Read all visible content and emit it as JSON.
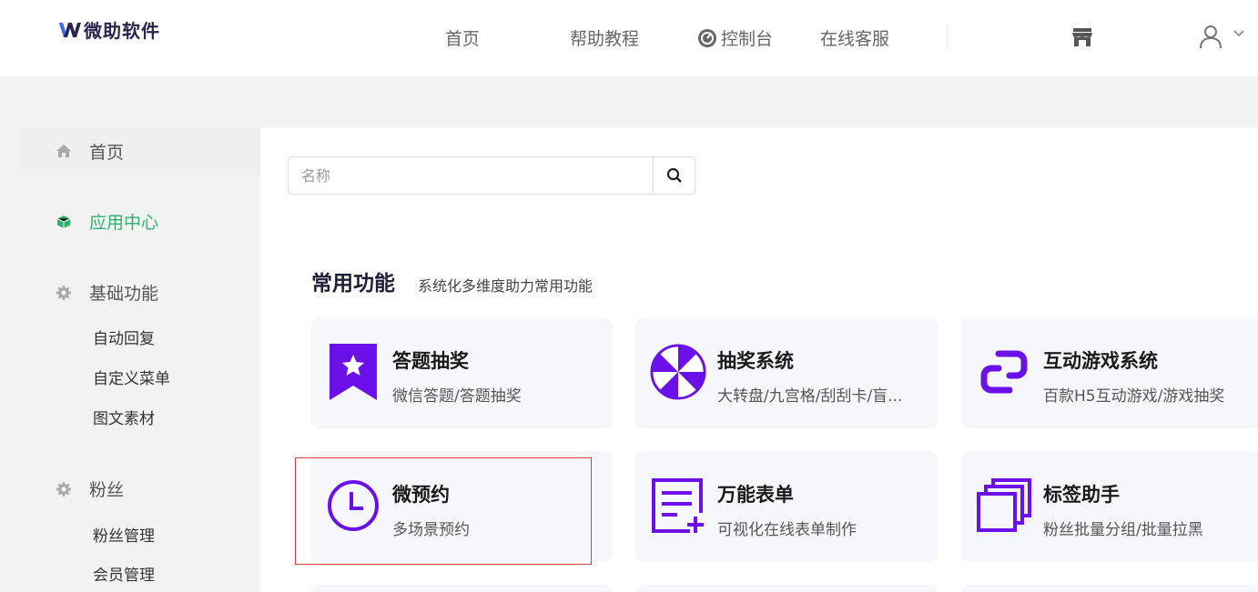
{
  "header": {
    "logo_text": "微助软件",
    "nav": {
      "home": "首页",
      "help": "帮助教程",
      "console": "控制台",
      "service": "在线客服"
    }
  },
  "sidebar": {
    "home": "首页",
    "app_center": "应用中心",
    "basic": "基础功能",
    "basic_items": [
      "自动回复",
      "自定义菜单",
      "图文素材"
    ],
    "fans": "粉丝",
    "fans_items": [
      "粉丝管理",
      "会员管理"
    ]
  },
  "search": {
    "placeholder": "名称"
  },
  "section": {
    "title": "常用功能",
    "subtitle": "系统化多维度助力常用功能"
  },
  "cards": [
    {
      "title": "答题抽奖",
      "desc": "微信答题/答题抽奖",
      "icon": "ribbon-star-icon"
    },
    {
      "title": "抽奖系统",
      "desc": "大转盘/九宫格/刮刮卡/盲...",
      "icon": "wheel-icon"
    },
    {
      "title": "互动游戏系统",
      "desc": "百款H5互动游戏/游戏抽奖",
      "icon": "link-chain-icon"
    },
    {
      "title": "微预约",
      "desc": "多场景预约",
      "icon": "clock-icon"
    },
    {
      "title": "万能表单",
      "desc": "可视化在线表单制作",
      "icon": "form-icon"
    },
    {
      "title": "标签助手",
      "desc": "粉丝批量分组/批量拉黑",
      "icon": "stacked-squares-icon"
    }
  ],
  "colors": {
    "brand_purple": "#6b10e8",
    "active_green": "#2db26b",
    "highlight_red": "#e23b3b"
  }
}
